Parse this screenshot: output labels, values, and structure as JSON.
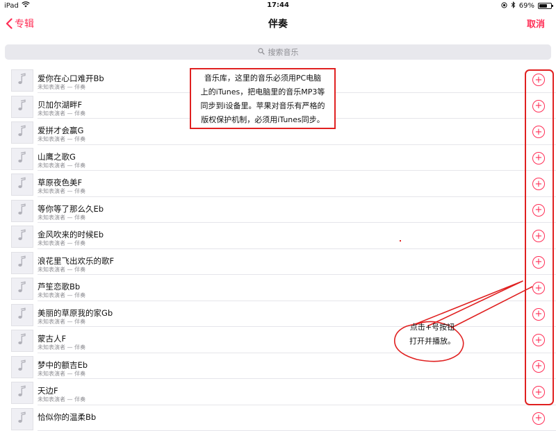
{
  "status_bar": {
    "device": "iPad",
    "time": "17:44",
    "battery_text": "69%",
    "battery_level": 0.69
  },
  "nav": {
    "back_label": "专辑",
    "title": "伴奏",
    "cancel_label": "取消"
  },
  "search": {
    "placeholder": "搜索音乐"
  },
  "songs": [
    {
      "title": "爱你在心口难开Bb",
      "subtitle": "未知表演者 — 伴奏"
    },
    {
      "title": "贝加尔湖畔F",
      "subtitle": "未知表演者 — 伴奏"
    },
    {
      "title": "爱拼才会赢G",
      "subtitle": "未知表演者 — 伴奏"
    },
    {
      "title": "山鹰之歌G",
      "subtitle": "未知表演者 — 伴奏"
    },
    {
      "title": "草原夜色美F",
      "subtitle": "未知表演者 — 伴奏"
    },
    {
      "title": "等你等了那么久Eb",
      "subtitle": "未知表演者 — 伴奏"
    },
    {
      "title": "金风吹来的时候Eb",
      "subtitle": "未知表演者 — 伴奏"
    },
    {
      "title": "浪花里飞出欢乐的歌F",
      "subtitle": "未知表演者 — 伴奏"
    },
    {
      "title": "芦笙恋歌Bb",
      "subtitle": "未知表演者 — 伴奏"
    },
    {
      "title": "美丽的草原我的家Gb",
      "subtitle": "未知表演者 — 伴奏"
    },
    {
      "title": "蒙古人F",
      "subtitle": "未知表演者 — 伴奏"
    },
    {
      "title": "梦中的额吉Eb",
      "subtitle": "未知表演者 — 伴奏"
    },
    {
      "title": "天边F",
      "subtitle": "未知表演者 — 伴奏"
    },
    {
      "title": "恰似你的温柔Bb",
      "subtitle": ""
    }
  ],
  "annotations": {
    "library_note_lines": [
      "音乐库，这里的音乐必须用PC电脑",
      "上的iTunes，把电脑里的音乐MP3等",
      "同步到i设备里。苹果对音乐有严格的",
      "版权保护机制，必须用iTunes同步。"
    ],
    "add_callout_lines": [
      "点击+号按钮",
      "打开并播放。"
    ]
  },
  "icons": {
    "wifi": "wifi-icon",
    "back": "chevron-left-icon",
    "search": "search-icon",
    "music_note": "music-note-icon",
    "add": "plus-circle-icon",
    "location": "location-icon",
    "bluetooth": "bluetooth-icon",
    "battery": "battery-icon"
  },
  "colors": {
    "accent": "#ff2d55",
    "annotation": "#e02020",
    "secondary_text": "#8e8e93"
  }
}
